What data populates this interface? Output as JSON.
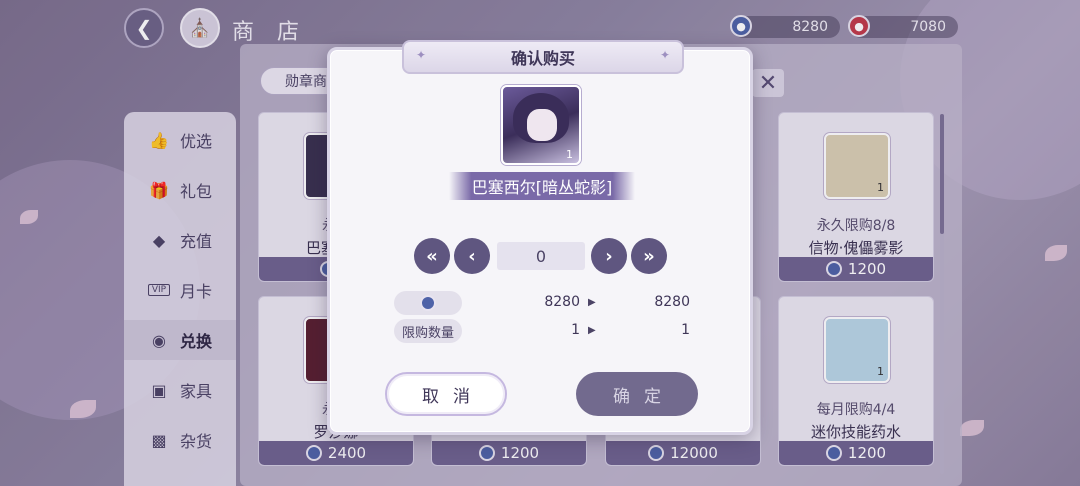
{
  "header": {
    "title": "商 店",
    "currency_blue": "8280",
    "currency_red": "7080"
  },
  "tab": {
    "label": "勋章商"
  },
  "sidebar": {
    "items": [
      {
        "label": "优选",
        "icon": "thumbs-up-icon"
      },
      {
        "label": "礼包",
        "icon": "gift-icon"
      },
      {
        "label": "充值",
        "icon": "gem-icon"
      },
      {
        "label": "月卡",
        "icon": "vip-card-icon"
      },
      {
        "label": "兑换",
        "icon": "exchange-icon"
      },
      {
        "label": "家具",
        "icon": "sofa-icon"
      },
      {
        "label": "杂货",
        "icon": "bag-icon"
      }
    ],
    "active_index": 4
  },
  "cards": [
    {
      "limit": "永久",
      "name": "巴塞西尔",
      "price": "2",
      "qty": ""
    },
    {
      "limit": "永久限购8/8",
      "name": "信物·傀儡雾影",
      "price": "1200",
      "qty": "1"
    },
    {
      "limit": "永久",
      "name": "罗莎娜",
      "price": "2400",
      "qty": ""
    },
    {
      "limit": "",
      "name": "",
      "price": "1200",
      "qty": ""
    },
    {
      "limit": "",
      "name": "",
      "price": "12000",
      "qty": ""
    },
    {
      "limit": "每月限购4/4",
      "name": "迷你技能药水",
      "price": "1200",
      "qty": "1"
    }
  ],
  "dialog": {
    "title": "确认购买",
    "item_name": "巴塞西尔[暗丛蛇影]",
    "item_qty": "1",
    "quantity": "0",
    "currency_before": "8280",
    "currency_after": "8280",
    "limit_label": "限购数量",
    "limit_before": "1",
    "limit_after": "1",
    "cancel_label": "取消",
    "confirm_label": "确定"
  }
}
